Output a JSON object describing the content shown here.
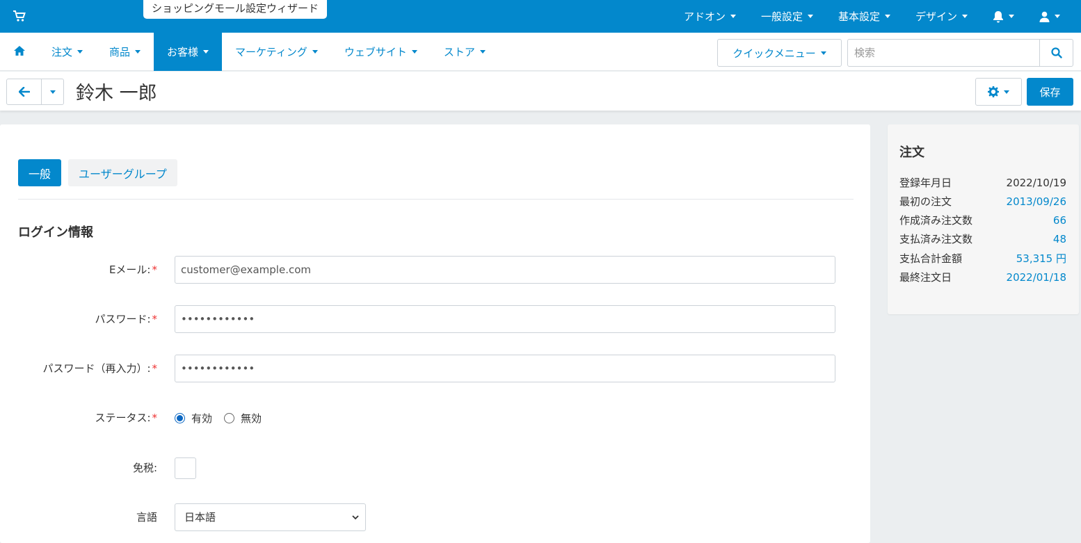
{
  "topbar": {
    "wizard_label": "ショッピングモール設定ウィザード",
    "menu": [
      {
        "label": "アドオン"
      },
      {
        "label": "一般設定"
      },
      {
        "label": "基本設定"
      },
      {
        "label": "デザイン"
      }
    ],
    "icons": [
      "cart-icon",
      "bell-icon",
      "user-icon"
    ]
  },
  "nav": {
    "items": [
      {
        "label": "注文"
      },
      {
        "label": "商品"
      },
      {
        "label": "お客様"
      },
      {
        "label": "マーケティング"
      },
      {
        "label": "ウェブサイト"
      },
      {
        "label": "ストア"
      }
    ],
    "active_index": 2,
    "quick_menu_label": "クイックメニュー",
    "search_placeholder": "検索"
  },
  "title_bar": {
    "title": "鈴木 一郎",
    "save_label": "保存"
  },
  "tabs": [
    {
      "label": "一般"
    },
    {
      "label": "ユーザーグループ"
    }
  ],
  "form": {
    "section_title": "ログイン情報",
    "email_label": "Eメール:",
    "email_value": "customer@example.com",
    "password_label": "パスワード:",
    "password_value": "••••••••••••",
    "password_confirm_label": "パスワード（再入力）:",
    "password_confirm_value": "••••••••••••",
    "required_mark": "*",
    "status_label": "ステータス:",
    "status_options": [
      "有効",
      "無効"
    ],
    "status_selected": "有効",
    "tax_exempt_label": "免税:",
    "tax_exempt_checked": false,
    "language_label": "言語",
    "language_value": "日本語"
  },
  "sidebar": {
    "title": "注文",
    "stats": [
      {
        "label": "登録年月日",
        "value": "2022/10/19",
        "link": false
      },
      {
        "label": "最初の注文",
        "value": "2013/09/26",
        "link": true
      },
      {
        "label": "作成済み注文数",
        "value": "66",
        "link": true
      },
      {
        "label": "支払済み注文数",
        "value": "48",
        "link": true
      },
      {
        "label": "支払合計金額",
        "value": "53,315 円",
        "link": true
      },
      {
        "label": "最終注文日",
        "value": "2022/01/18",
        "link": true
      }
    ]
  },
  "colors": {
    "primary": "#0388cc",
    "required": "#ee3333"
  }
}
